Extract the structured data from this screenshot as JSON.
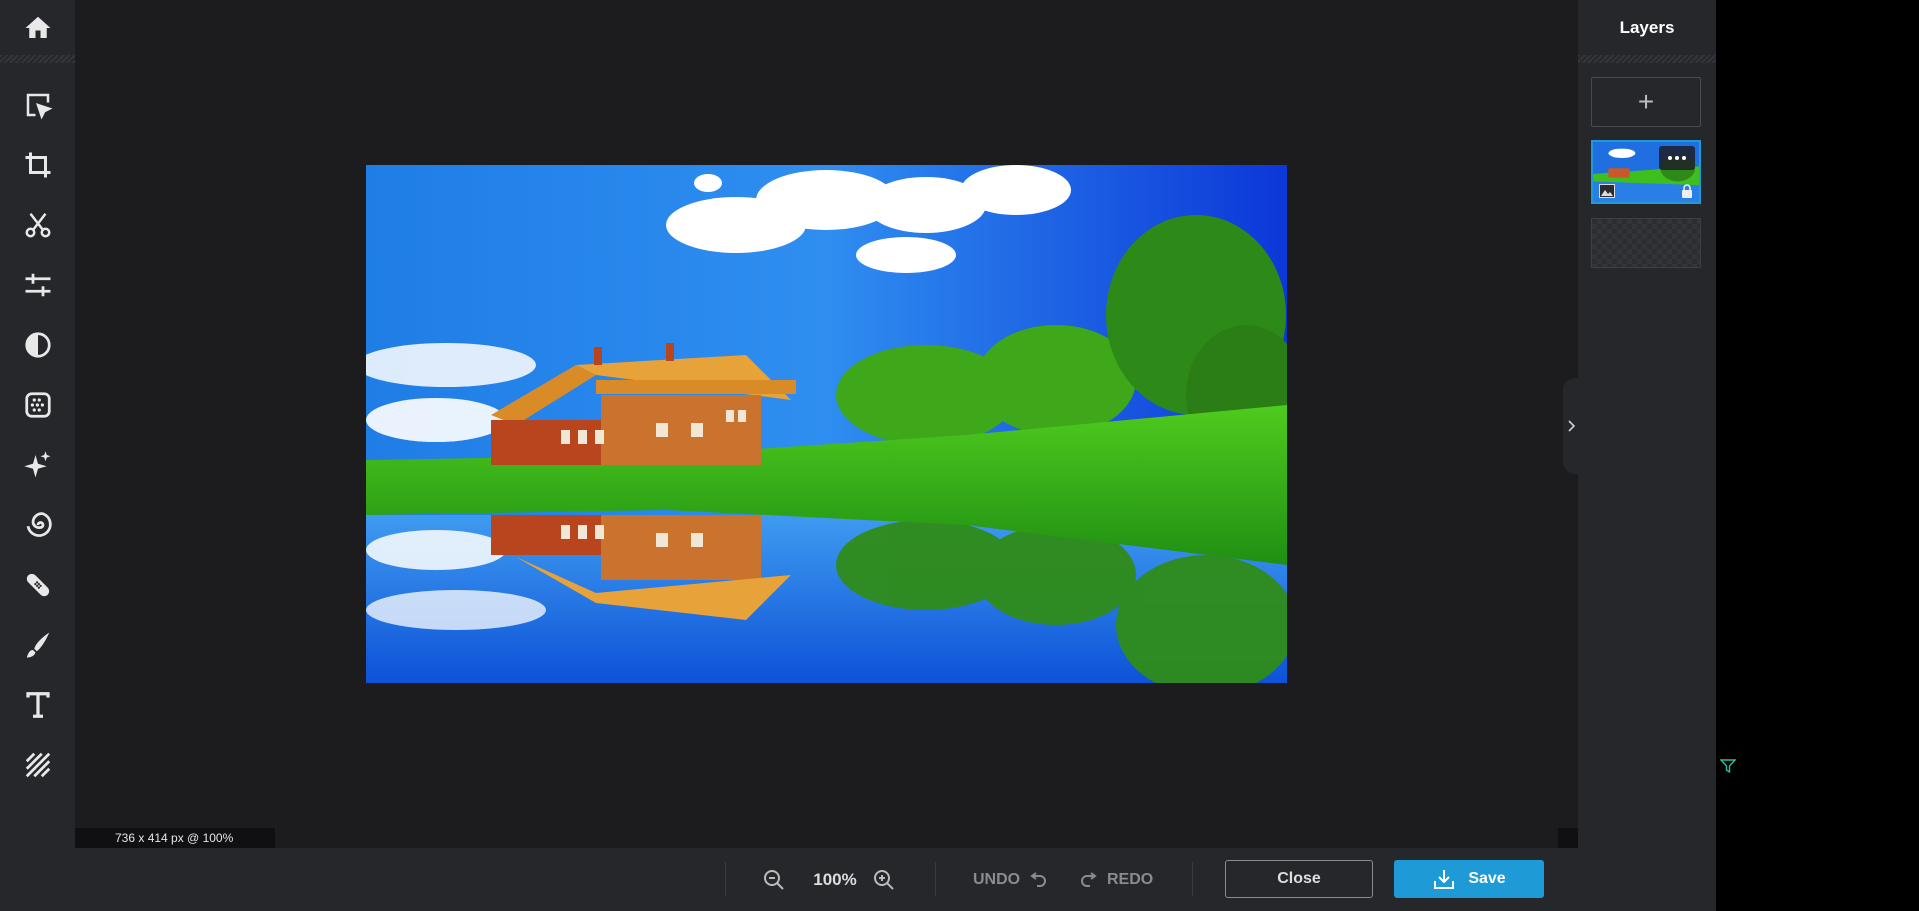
{
  "layers_panel": {
    "title": "Layers",
    "add_label": "+"
  },
  "canvas": {
    "dimensions_label": "736 x 414 px @ 100%"
  },
  "bottom_bar": {
    "zoom_value": "100%",
    "undo_label": "UNDO",
    "redo_label": "REDO",
    "close_label": "Close",
    "save_label": "Save"
  },
  "tools": [
    "home-icon",
    "select-arrow-icon",
    "crop-icon",
    "scissors-icon",
    "adjust-sliders-icon",
    "contrast-icon",
    "effects-grid-icon",
    "sparkle-icon",
    "spiral-icon",
    "bandage-icon",
    "brush-icon",
    "text-icon",
    "texture-lines-icon"
  ],
  "colors": {
    "accent": "#1e9bd7",
    "panel": "#26272b",
    "canvas_bg": "#1c1c1f"
  }
}
